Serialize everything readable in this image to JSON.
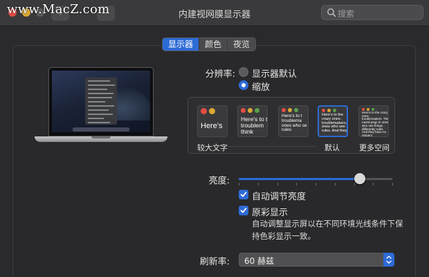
{
  "window": {
    "title": "内建视网膜显示器",
    "watermark": "www.MacZ.com",
    "search_placeholder": "搜索"
  },
  "tabs": [
    {
      "label": "显示器",
      "active": true
    },
    {
      "label": "颜色",
      "active": false
    },
    {
      "label": "夜览",
      "active": false
    }
  ],
  "resolution": {
    "label": "分辨率:",
    "options": [
      {
        "label": "显示器默认",
        "selected": false
      },
      {
        "label": "缩放",
        "selected": true
      }
    ],
    "scales": [
      {
        "preview_text": "Here's",
        "caption": "较大文字"
      },
      {
        "preview_text": "Here's to t troublem think",
        "caption": ""
      },
      {
        "preview_text": "Here's to t troublema ones who se rules",
        "caption": ""
      },
      {
        "preview_text": "Here's to the crazy ones. troublemakers. ones who see rules. And they",
        "caption": "默认"
      },
      {
        "preview_text": "Here's to the crazy ones troublemakers. The round pegs in ones who see things differently rules. And they have no respect",
        "caption": "更多空间"
      }
    ]
  },
  "brightness": {
    "label": "亮度:",
    "level": 0.79
  },
  "checkboxes": [
    {
      "label": "自动调节亮度",
      "checked": true
    },
    {
      "label": "原彩显示",
      "checked": true
    }
  ],
  "true_tone_desc": "自动调整显示屏以在不同环境光线条件下保持色彩显示一致。",
  "refresh": {
    "label": "刷新率:",
    "value": "60 赫兹"
  },
  "colors": {
    "accent": "#2d6bd6",
    "background": "#2a2a2c"
  }
}
